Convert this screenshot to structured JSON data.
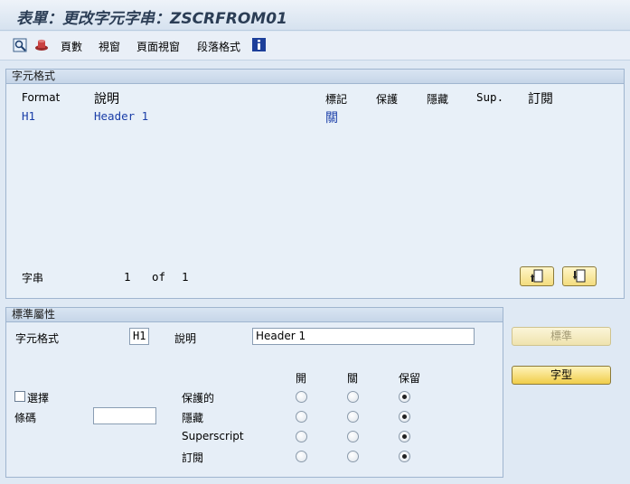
{
  "window": {
    "title": "表單：更改字元字串：ZSCRFROM01"
  },
  "toolbar": {
    "items": [
      "頁數",
      "視窗",
      "頁面視窗",
      "段落格式"
    ]
  },
  "char_format": {
    "group_title": "字元格式",
    "columns": {
      "format": "Format",
      "desc": "說明",
      "mark": "標記",
      "protect": "保護",
      "hidden": "隱藏",
      "sup": "Sup.",
      "sub": "訂閱"
    },
    "row": {
      "format": "H1",
      "desc": "Header 1",
      "mark": "關"
    },
    "footer": {
      "label": "字串",
      "current": "1",
      "of": "of",
      "total": "1"
    }
  },
  "std_attr": {
    "group_title": "標準屬性",
    "format_label": "字元格式",
    "format_value": "H1",
    "desc_label": "說明",
    "desc_value": "Header 1",
    "radio_headers": [
      "開",
      "關",
      "保留"
    ],
    "select_label": "選擇",
    "bar_label": "條碼",
    "rows": [
      {
        "label": "保護的",
        "selected": 2
      },
      {
        "label": "隱藏",
        "selected": 2
      },
      {
        "label": "Superscript",
        "selected": 2
      },
      {
        "label": "訂閱",
        "selected": 2
      }
    ]
  },
  "side_buttons": {
    "standard": "標準",
    "font": "字型"
  }
}
